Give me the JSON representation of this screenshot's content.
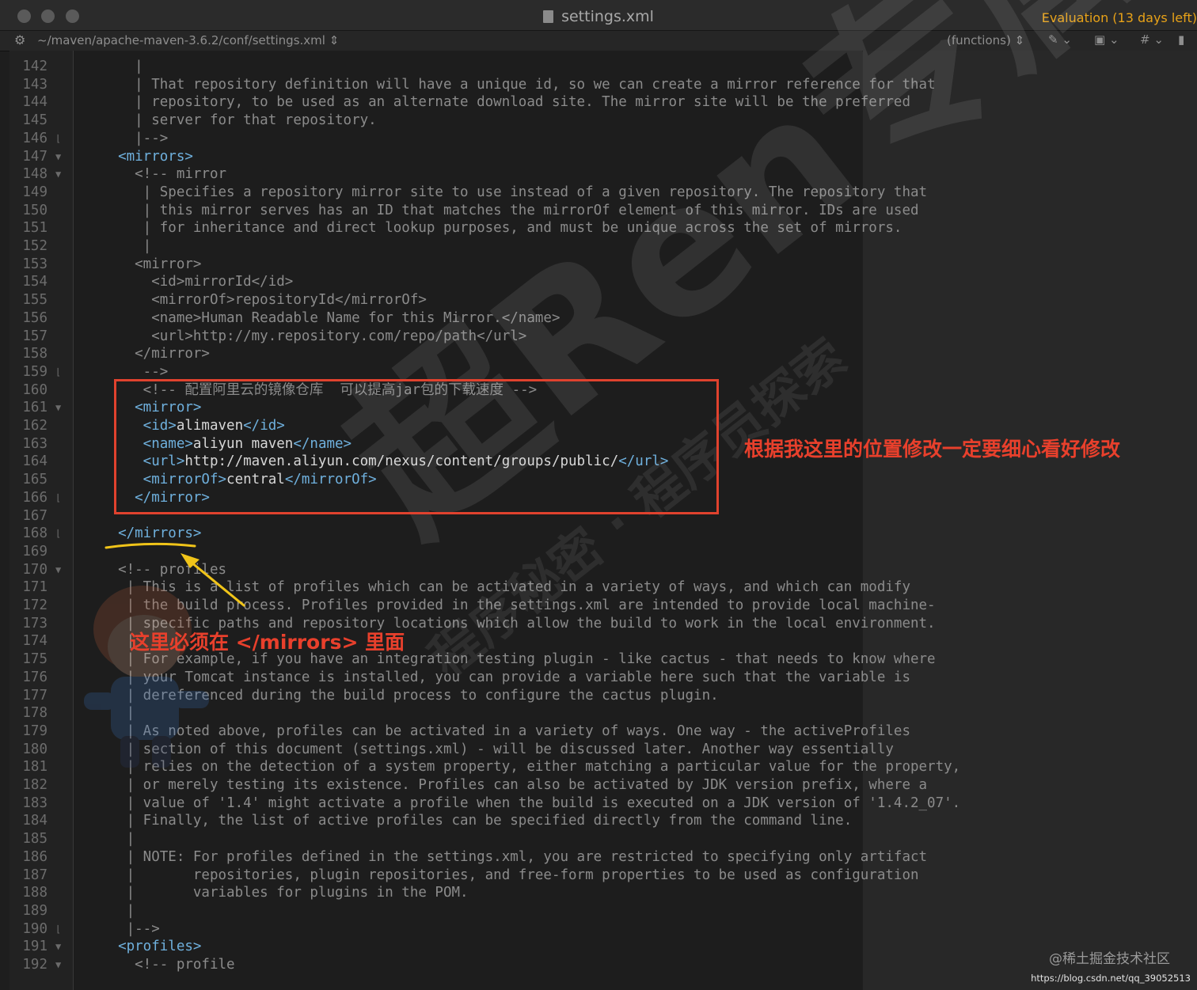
{
  "window": {
    "title": "settings.xml",
    "evaluation": "Evaluation (13 days left)"
  },
  "navbar": {
    "path": "~/maven/apache-maven-3.6.2/conf/settings.xml",
    "symbol_selector": "(functions)"
  },
  "icons": {
    "gear": "gear-icon",
    "file": "file-icon",
    "bookmark": "bookmark-icon",
    "clipboard": "clipboard-icon",
    "hash": "hash-icon",
    "document": "document-icon"
  },
  "colors": {
    "comment": "#8b8b8b",
    "tag": "#6fb0dd",
    "text": "#d7d7d7",
    "annotation_red": "#e0422e",
    "annotation_yellow": "#f0c419",
    "evaluation": "#e8a218"
  },
  "lines": [
    {
      "n": "142",
      "fold": "",
      "tokens": [
        {
          "t": "    |",
          "c": "cm"
        }
      ]
    },
    {
      "n": "143",
      "fold": "",
      "tokens": [
        {
          "t": "    | That repository definition will have a unique id, so we can create a mirror reference for that",
          "c": "cm"
        }
      ]
    },
    {
      "n": "144",
      "fold": "",
      "tokens": [
        {
          "t": "    | repository, to be used as an alternate download site. The mirror site will be the preferred",
          "c": "cm"
        }
      ]
    },
    {
      "n": "145",
      "fold": "",
      "tokens": [
        {
          "t": "    | server for that repository.",
          "c": "cm"
        }
      ]
    },
    {
      "n": "146",
      "fold": "end",
      "tokens": [
        {
          "t": "    |-->",
          "c": "cm"
        }
      ]
    },
    {
      "n": "147",
      "fold": "start",
      "tokens": [
        {
          "t": "  <mirrors>",
          "c": "tg"
        }
      ]
    },
    {
      "n": "148",
      "fold": "start",
      "tokens": [
        {
          "t": "    <!-- mirror",
          "c": "cm"
        }
      ]
    },
    {
      "n": "149",
      "fold": "",
      "tokens": [
        {
          "t": "     | Specifies a repository mirror site to use instead of a given repository. The repository that",
          "c": "cm"
        }
      ]
    },
    {
      "n": "150",
      "fold": "",
      "tokens": [
        {
          "t": "     | this mirror serves has an ID that matches the mirrorOf element of this mirror. IDs are used",
          "c": "cm"
        }
      ]
    },
    {
      "n": "151",
      "fold": "",
      "tokens": [
        {
          "t": "     | for inheritance and direct lookup purposes, and must be unique across the set of mirrors.",
          "c": "cm"
        }
      ]
    },
    {
      "n": "152",
      "fold": "",
      "tokens": [
        {
          "t": "     |",
          "c": "cm"
        }
      ]
    },
    {
      "n": "153",
      "fold": "",
      "tokens": [
        {
          "t": "    <mirror>",
          "c": "cm"
        }
      ]
    },
    {
      "n": "154",
      "fold": "",
      "tokens": [
        {
          "t": "      <id>mirrorId</id>",
          "c": "cm"
        }
      ]
    },
    {
      "n": "155",
      "fold": "",
      "tokens": [
        {
          "t": "      <mirrorOf>repositoryId</mirrorOf>",
          "c": "cm"
        }
      ]
    },
    {
      "n": "156",
      "fold": "",
      "tokens": [
        {
          "t": "      <name>Human Readable Name for this Mirror.</name>",
          "c": "cm"
        }
      ]
    },
    {
      "n": "157",
      "fold": "",
      "tokens": [
        {
          "t": "      <url>http://my.repository.com/repo/path</url>",
          "c": "cm"
        }
      ]
    },
    {
      "n": "158",
      "fold": "",
      "tokens": [
        {
          "t": "    </mirror>",
          "c": "cm"
        }
      ]
    },
    {
      "n": "159",
      "fold": "end",
      "tokens": [
        {
          "t": "     -->",
          "c": "cm"
        }
      ]
    },
    {
      "n": "160",
      "fold": "",
      "tokens": [
        {
          "t": "     <!-- 配置阿里云的镜像仓库  可以提高jar包的下载速度 -->",
          "c": "cm"
        }
      ]
    },
    {
      "n": "161",
      "fold": "start",
      "tokens": [
        {
          "t": "    <mirror>",
          "c": "tg"
        }
      ]
    },
    {
      "n": "162",
      "fold": "",
      "tokens": [
        {
          "t": "     <id>",
          "c": "tg"
        },
        {
          "t": "alimaven",
          "c": "tx"
        },
        {
          "t": "</id>",
          "c": "tg"
        }
      ]
    },
    {
      "n": "163",
      "fold": "",
      "tokens": [
        {
          "t": "     <name>",
          "c": "tg"
        },
        {
          "t": "aliyun maven",
          "c": "tx"
        },
        {
          "t": "</name>",
          "c": "tg"
        }
      ]
    },
    {
      "n": "164",
      "fold": "",
      "tokens": [
        {
          "t": "     <url>",
          "c": "tg"
        },
        {
          "t": "http://maven.aliyun.com/nexus/content/groups/public/",
          "c": "tx"
        },
        {
          "t": "</url>",
          "c": "tg"
        }
      ]
    },
    {
      "n": "165",
      "fold": "",
      "tokens": [
        {
          "t": "     <mirrorOf>",
          "c": "tg"
        },
        {
          "t": "central",
          "c": "tx"
        },
        {
          "t": "</mirrorOf>",
          "c": "tg"
        }
      ]
    },
    {
      "n": "166",
      "fold": "end",
      "tokens": [
        {
          "t": "    </mirror>",
          "c": "tg"
        }
      ]
    },
    {
      "n": "167",
      "fold": "",
      "tokens": [
        {
          "t": "",
          "c": "cm"
        }
      ]
    },
    {
      "n": "168",
      "fold": "end",
      "tokens": [
        {
          "t": "  </mirrors>",
          "c": "tg"
        }
      ]
    },
    {
      "n": "169",
      "fold": "",
      "tokens": [
        {
          "t": "",
          "c": "cm"
        }
      ]
    },
    {
      "n": "170",
      "fold": "start",
      "tokens": [
        {
          "t": "  <!-- profiles",
          "c": "cm"
        }
      ]
    },
    {
      "n": "171",
      "fold": "",
      "tokens": [
        {
          "t": "   | This is a list of profiles which can be activated in a variety of ways, and which can modify",
          "c": "cm"
        }
      ]
    },
    {
      "n": "172",
      "fold": "",
      "tokens": [
        {
          "t": "   | the build process. Profiles provided in the settings.xml are intended to provide local machine-",
          "c": "cm"
        }
      ]
    },
    {
      "n": "173",
      "fold": "",
      "tokens": [
        {
          "t": "   | specific paths and repository locations which allow the build to work in the local environment.",
          "c": "cm"
        }
      ]
    },
    {
      "n": "174",
      "fold": "",
      "tokens": [
        {
          "t": "   |",
          "c": "cm"
        }
      ]
    },
    {
      "n": "175",
      "fold": "",
      "tokens": [
        {
          "t": "   | For example, if you have an integration testing plugin - like cactus - that needs to know where",
          "c": "cm"
        }
      ]
    },
    {
      "n": "176",
      "fold": "",
      "tokens": [
        {
          "t": "   | your Tomcat instance is installed, you can provide a variable here such that the variable is",
          "c": "cm"
        }
      ]
    },
    {
      "n": "177",
      "fold": "",
      "tokens": [
        {
          "t": "   | dereferenced during the build process to configure the cactus plugin.",
          "c": "cm"
        }
      ]
    },
    {
      "n": "178",
      "fold": "",
      "tokens": [
        {
          "t": "   |",
          "c": "cm"
        }
      ]
    },
    {
      "n": "179",
      "fold": "",
      "tokens": [
        {
          "t": "   | As noted above, profiles can be activated in a variety of ways. One way - the activeProfiles",
          "c": "cm"
        }
      ]
    },
    {
      "n": "180",
      "fold": "",
      "tokens": [
        {
          "t": "   | section of this document (settings.xml) - will be discussed later. Another way essentially",
          "c": "cm"
        }
      ]
    },
    {
      "n": "181",
      "fold": "",
      "tokens": [
        {
          "t": "   | relies on the detection of a system property, either matching a particular value for the property,",
          "c": "cm"
        }
      ]
    },
    {
      "n": "182",
      "fold": "",
      "tokens": [
        {
          "t": "   | or merely testing its existence. Profiles can also be activated by JDK version prefix, where a",
          "c": "cm"
        }
      ]
    },
    {
      "n": "183",
      "fold": "",
      "tokens": [
        {
          "t": "   | value of '1.4' might activate a profile when the build is executed on a JDK version of '1.4.2_07'.",
          "c": "cm"
        }
      ]
    },
    {
      "n": "184",
      "fold": "",
      "tokens": [
        {
          "t": "   | Finally, the list of active profiles can be specified directly from the command line.",
          "c": "cm"
        }
      ]
    },
    {
      "n": "185",
      "fold": "",
      "tokens": [
        {
          "t": "   |",
          "c": "cm"
        }
      ]
    },
    {
      "n": "186",
      "fold": "",
      "tokens": [
        {
          "t": "   | NOTE: For profiles defined in the settings.xml, you are restricted to specifying only artifact",
          "c": "cm"
        }
      ]
    },
    {
      "n": "187",
      "fold": "",
      "tokens": [
        {
          "t": "   |       repositories, plugin repositories, and free-form properties to be used as configuration",
          "c": "cm"
        }
      ]
    },
    {
      "n": "188",
      "fold": "",
      "tokens": [
        {
          "t": "   |       variables for plugins in the POM.",
          "c": "cm"
        }
      ]
    },
    {
      "n": "189",
      "fold": "",
      "tokens": [
        {
          "t": "   |",
          "c": "cm"
        }
      ]
    },
    {
      "n": "190",
      "fold": "end",
      "tokens": [
        {
          "t": "   |-->",
          "c": "cm"
        }
      ]
    },
    {
      "n": "191",
      "fold": "start",
      "tokens": [
        {
          "t": "  <profiles>",
          "c": "tg"
        }
      ]
    },
    {
      "n": "192",
      "fold": "start",
      "tokens": [
        {
          "t": "    <!-- profile",
          "c": "cm"
        }
      ]
    }
  ],
  "annotations": {
    "right_note": "根据我这里的位置修改一定要细心看好修改",
    "left_note": "这里必须在   </mirrors> 里面"
  },
  "watermark": {
    "main": "超Ren专属",
    "sub": "程序秘密 · 程序员探索"
  },
  "credits": {
    "site": "@稀土掘金技术社区",
    "url": "https://blog.csdn.net/qq_39052513"
  }
}
